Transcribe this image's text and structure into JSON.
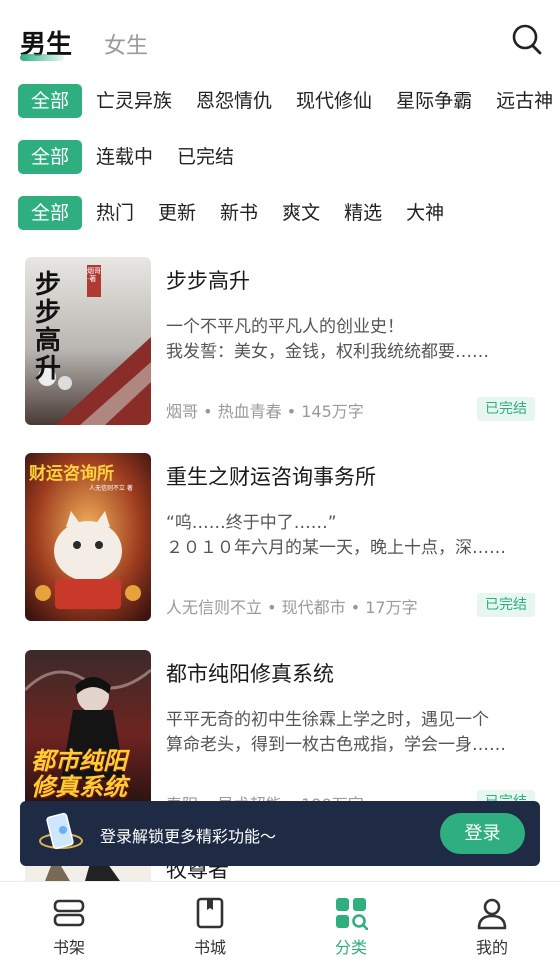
{
  "header": {
    "tabs": [
      {
        "label": "男生",
        "active": true
      },
      {
        "label": "女生",
        "active": false
      }
    ],
    "search_icon": "search-icon"
  },
  "filters": {
    "category": [
      "全部",
      "亡灵异族",
      "恩怨情仇",
      "现代修仙",
      "星际争霸",
      "远古神"
    ],
    "status": [
      "全部",
      "连载中",
      "已完结"
    ],
    "sort": [
      "全部",
      "热门",
      "更新",
      "新书",
      "爽文",
      "精选",
      "大神"
    ]
  },
  "books": [
    {
      "title": "步步高升",
      "desc": [
        "一个不平凡的平凡人的创业史！",
        "我发誓：美女，金钱，权利我统统都要……"
      ],
      "meta": "烟哥 • 热血青春 • 145万字",
      "status": "已完结",
      "cover_text": "步步高升",
      "cover_stamp": "烟哥·著"
    },
    {
      "title": "重生之财运咨询事务所",
      "desc": [
        "“呜……终于中了……”",
        "２０１０年六月的某一天，晚上十点，深……"
      ],
      "meta": "人无信则不立 • 现代都市 • 17万字",
      "status": "已完结",
      "cover_text": "财运咨询所",
      "cover_stamp": "人无信则不立 著"
    },
    {
      "title": "都市纯阳修真系统",
      "desc": [
        "平平无奇的初中生徐霖上学之时，遇见一个",
        "算命老头，得到一枚古色戒指，学会一身……"
      ],
      "meta": "春阳 • 异术超能 • 190万字",
      "status": "已完结",
      "cover_text": "都市纯阳修真系统",
      "cover_stamp": ""
    },
    {
      "title": "牧尊者",
      "desc": [],
      "meta": "",
      "status": "",
      "cover_text": "",
      "cover_stamp": ""
    }
  ],
  "login_banner": {
    "text": "登录解锁更多精彩功能～",
    "button": "登录"
  },
  "bottom_nav": [
    {
      "label": "书架",
      "icon": "bookshelf-icon",
      "active": false
    },
    {
      "label": "书城",
      "icon": "bookstore-icon",
      "active": false
    },
    {
      "label": "分类",
      "icon": "category-icon",
      "active": true
    },
    {
      "label": "我的",
      "icon": "profile-icon",
      "active": false
    }
  ],
  "colors": {
    "accent": "#2fae7f",
    "banner": "#1f2a44"
  }
}
